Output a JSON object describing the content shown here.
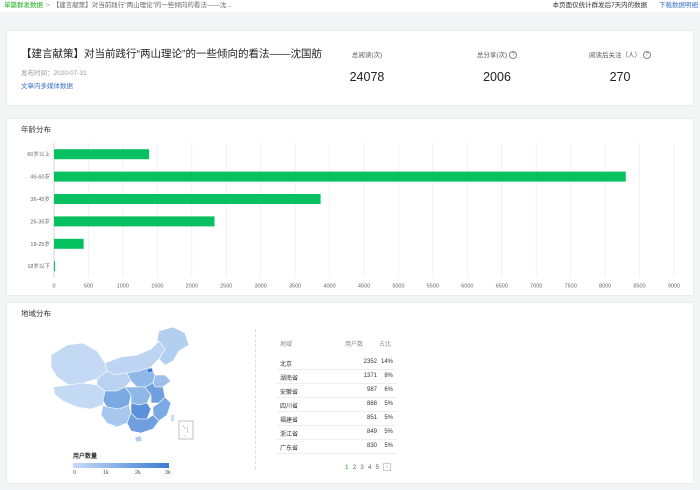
{
  "breadcrumb": {
    "root": "单篇群发数据",
    "current": "【建言献策】对当前践行\"两山理论\"的一些倾向的看法——沈..."
  },
  "topbar": {
    "note": "本页面仅统计群发后7天内的数据",
    "download": "下载数据明细"
  },
  "article": {
    "title": "【建言献策】对当前践行“两山理论”的一些倾向的看法——沈国舫",
    "date": "发布时间：2020-07-31",
    "media_link": "文章内多媒体数据"
  },
  "stats": [
    {
      "label": "总阅读(次)",
      "value": "24078",
      "help": false
    },
    {
      "label": "总分享(次)",
      "value": "2006",
      "help": true
    },
    {
      "label": "阅读后关注（人）",
      "value": "270",
      "help": true
    }
  ],
  "age_section": {
    "title": "年龄分布"
  },
  "chart_data": {
    "type": "bar",
    "orientation": "horizontal",
    "categories": [
      "60岁以上",
      "46-60岁",
      "36-45岁",
      "26-35岁",
      "18-25岁",
      "18岁以下"
    ],
    "values": [
      1380,
      8300,
      3870,
      2330,
      430,
      15
    ],
    "xlim": [
      0,
      9000
    ],
    "xticks": [
      "0",
      "500",
      "1000",
      "1500",
      "2000",
      "2500",
      "3000",
      "3500",
      "4000",
      "4500",
      "5000",
      "5500",
      "6000",
      "6500",
      "7000",
      "7500",
      "8000",
      "8500",
      "9000"
    ],
    "bar_color": "#07c160",
    "grid": true
  },
  "region_section": {
    "title": "地域分布"
  },
  "map_legend": {
    "title": "用户数量",
    "ticks": [
      "0",
      "1k",
      "2k",
      "3k"
    ],
    "colors": [
      "#c7dcf5",
      "#3a7bd5"
    ]
  },
  "region_table": {
    "headers": [
      "地域",
      "用户数",
      "占比"
    ],
    "rows": [
      [
        "北京",
        "2352",
        "14%"
      ],
      [
        "湖南省",
        "1371",
        "8%"
      ],
      [
        "安徽省",
        "987",
        "6%"
      ],
      [
        "四川省",
        "868",
        "5%"
      ],
      [
        "福建省",
        "851",
        "5%"
      ],
      [
        "浙江省",
        "849",
        "5%"
      ],
      [
        "广东省",
        "830",
        "5%"
      ]
    ]
  },
  "pagination": {
    "pages": [
      "1",
      "2",
      "3",
      "4",
      "5"
    ],
    "active": "1",
    "next": "›"
  }
}
